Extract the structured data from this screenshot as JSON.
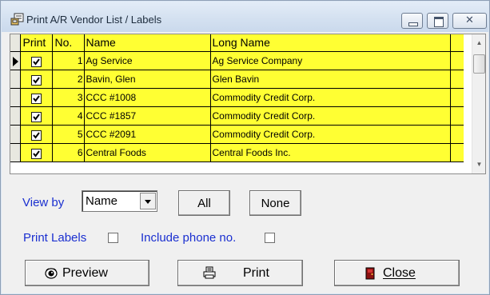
{
  "window": {
    "title": "Print A/R Vendor List / Labels"
  },
  "caption_buttons": {
    "close_glyph": "✕"
  },
  "grid": {
    "headers": {
      "print": "Print",
      "no": "No.",
      "name": "Name",
      "long_name": "Long Name"
    },
    "rows": [
      {
        "print": true,
        "no": "1",
        "name": "Ag Service",
        "long_name": "Ag Service Company"
      },
      {
        "print": true,
        "no": "2",
        "name": "Bavin, Glen",
        "long_name": "Glen Bavin"
      },
      {
        "print": true,
        "no": "3",
        "name": "CCC #1008",
        "long_name": "Commodity Credit Corp."
      },
      {
        "print": true,
        "no": "4",
        "name": "CCC #1857",
        "long_name": "Commodity Credit Corp."
      },
      {
        "print": true,
        "no": "5",
        "name": "CCC #2091",
        "long_name": "Commodity Credit Corp."
      },
      {
        "print": true,
        "no": "6",
        "name": "Central Foods",
        "long_name": "Central Foods Inc."
      }
    ],
    "selected_row": 0,
    "row_color": "#ffff33"
  },
  "controls": {
    "view_by_label": "View by",
    "view_by_value": "Name",
    "all_label": "All",
    "none_label": "None",
    "print_labels_label": "Print Labels",
    "print_labels_checked": false,
    "include_phone_label": "Include phone no.",
    "include_phone_checked": false
  },
  "actions": {
    "preview_label": "Preview",
    "preview_icon": "eye-icon",
    "print_label": "Print",
    "print_icon": "printer-icon",
    "close_label": "Close",
    "close_icon": "exit-door-icon"
  },
  "colors": {
    "label_blue": "#1a2fd0",
    "grid_yellow": "#ffff33"
  }
}
